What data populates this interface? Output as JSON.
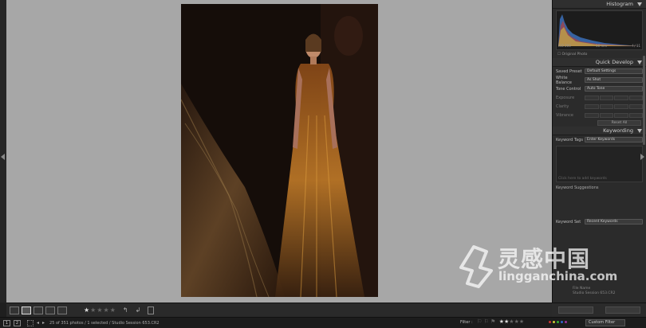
{
  "right_panel": {
    "histogram": {
      "title": "Histogram",
      "iso": "ISO 200",
      "focal": "56 mm",
      "aperture": "f / 11",
      "original_photo": "Original Photo"
    },
    "quick_develop": {
      "title": "Quick Develop",
      "saved_preset_label": "Saved Preset",
      "saved_preset_value": "Default Settings",
      "white_balance_label": "White Balance",
      "white_balance_value": "As Shot",
      "tone_control_label": "Tone Control",
      "tone_control_value": "Auto Tone",
      "exposure_label": "Exposure",
      "clarity_label": "Clarity",
      "vibrance_label": "Vibrance",
      "reset_all": "Reset All"
    },
    "keywording": {
      "title": "Keywording",
      "keyword_tags_label": "Keyword Tags",
      "keyword_tags_value": "Enter Keywords",
      "click_hint": "Click here to add keywords",
      "suggestions_label": "Keyword Suggestions",
      "keyword_set_label": "Keyword Set",
      "keyword_set_value": "Recent Keywords"
    },
    "metadata": {
      "file_name_label": "File Name",
      "file_name_value": "Studio Session 653.CR2"
    }
  },
  "filmstrip": {
    "view_one": "1",
    "view_two": "2",
    "info": "25 of 351 photos / 1 selected / Studio Session 653.CR2",
    "filter_label": "Filter :",
    "custom_filter": "Custom Filter"
  },
  "watermark": {
    "cn": "灵感中国",
    "en": "lingganchina.com"
  },
  "colors": {
    "canvas_bg": "#a7a7a7",
    "panel_bg": "#2b2b2b"
  }
}
